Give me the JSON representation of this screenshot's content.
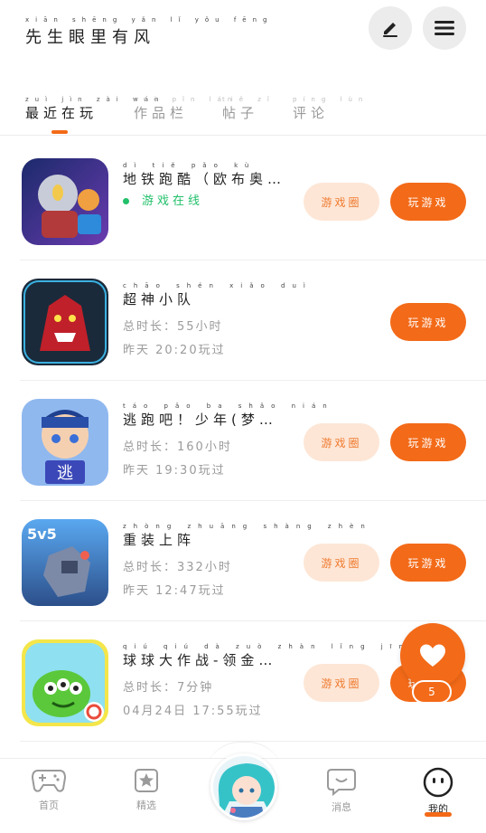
{
  "header": {
    "title": "先生眼里有风",
    "title_pinyin": "xiān shēng yǎn lǐ yǒu fēng",
    "edit_icon": "edit-icon",
    "menu_icon": "menu-icon"
  },
  "tabs": [
    {
      "label": "最近在玩",
      "pinyin": "zuì jìn zài wán",
      "active": true
    },
    {
      "label": "作品栏",
      "pinyin": "zuò pǐn lán",
      "active": false
    },
    {
      "label": "帖子",
      "pinyin": "tiě zǐ",
      "active": false
    },
    {
      "label": "评论",
      "pinyin": "píng lùn",
      "active": false
    }
  ],
  "games": [
    {
      "name": "地铁跑酷（欧布奥…",
      "pinyin": "dì tiě pǎo kù",
      "status": "游戏在线",
      "line1": "",
      "line2": "",
      "has_circle": true
    },
    {
      "name": "超神小队",
      "pinyin": "chāo shén xiǎo duì",
      "status": "",
      "line1": "总时长：55小时",
      "line2": "昨天 20:20玩过",
      "has_circle": false
    },
    {
      "name": "逃跑吧！少年(梦…",
      "pinyin": "táo pǎo ba shǎo nián",
      "status": "",
      "line1": "总时长：160小时",
      "line2": "昨天 19:30玩过",
      "has_circle": true
    },
    {
      "name": "重装上阵",
      "pinyin": "zhòng zhuāng shàng zhèn",
      "status": "",
      "line1": "总时长：332小时",
      "line2": "昨天 12:47玩过",
      "has_circle": true
    },
    {
      "name": "球球大作战-领金…",
      "pinyin": "qiú qiú dà zuò zhàn lǐng jīn",
      "status": "",
      "line1": "总时长：7分钟",
      "line2": "04月24日 17:55玩过",
      "has_circle": true
    }
  ],
  "buttons": {
    "circle": "游戏圈",
    "play": "玩游戏"
  },
  "fab": {
    "icon": "heart-icon",
    "count": "5"
  },
  "nav": [
    {
      "label": "首页",
      "icon": "gamepad-icon"
    },
    {
      "label": "精选",
      "icon": "star-icon"
    },
    {
      "label": "",
      "icon": "avatar"
    },
    {
      "label": "消息",
      "icon": "message-icon"
    },
    {
      "label": "我的",
      "icon": "face-icon"
    }
  ],
  "colors": {
    "accent": "#f36a18",
    "accent_light": "#fde6d6",
    "online": "#22c06a"
  }
}
